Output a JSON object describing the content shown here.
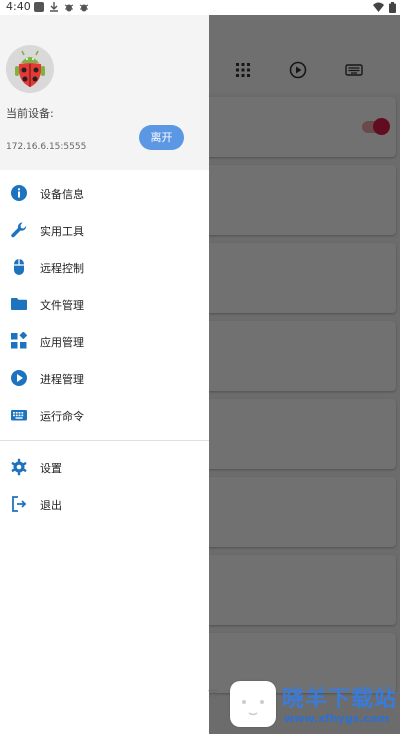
{
  "status_bar": {
    "time": "4:40"
  },
  "drawer": {
    "current_device_label": "当前设备:",
    "device_ip": "172.16.6.15:5555",
    "leave_button": "离开",
    "menu": [
      {
        "label": "设备信息",
        "icon": "info-icon"
      },
      {
        "label": "实用工具",
        "icon": "wrench-icon"
      },
      {
        "label": "远程控制",
        "icon": "mouse-icon"
      },
      {
        "label": "文件管理",
        "icon": "folder-icon"
      },
      {
        "label": "应用管理",
        "icon": "apps-icon"
      },
      {
        "label": "进程管理",
        "icon": "play-circle-icon"
      },
      {
        "label": "运行命令",
        "icon": "keyboard-icon"
      }
    ],
    "menu_secondary": [
      {
        "label": "设置",
        "icon": "gear-icon"
      },
      {
        "label": "退出",
        "icon": "exit-icon"
      }
    ]
  },
  "watermark": {
    "title": "晓羊下载站",
    "url": "www.xfhygs.com"
  },
  "colors": {
    "accent": "#1e73be",
    "leave_button": "#5b97e3",
    "toggle": "#d81b47"
  }
}
